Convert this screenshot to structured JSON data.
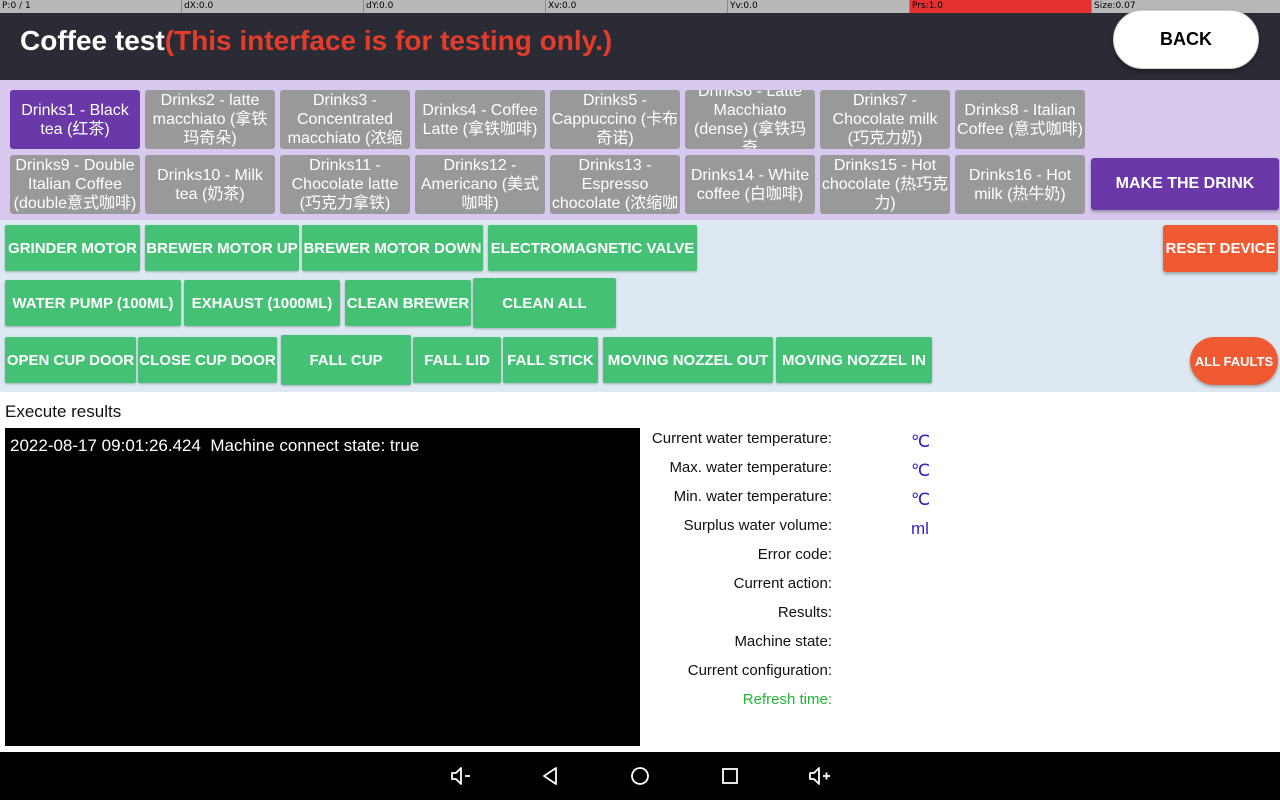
{
  "debug_bar": [
    "P:0 / 1",
    "dX:0.0",
    "dY:0.0",
    "Xv:0.0",
    "Yv:0.0",
    "Prs:1.0",
    "Size:0.07"
  ],
  "header": {
    "title": "Coffee test",
    "subtitle": "(This interface is for testing only.)",
    "back_label": "BACK"
  },
  "drinks": {
    "row1": [
      "Drinks1 - Black tea (红茶)",
      "Drinks2 - latte macchiato (拿铁玛奇朵)",
      "Drinks3 - Concentrated macchiato (浓缩",
      "Drinks4 - Coffee Latte (拿铁咖啡)",
      "Drinks5 - Cappuccino (卡布奇诺)",
      "Drinks6 - Latte Macchiato (dense) (拿铁玛奇",
      "Drinks7 - Chocolate milk (巧克力奶)",
      "Drinks8 - Italian Coffee (意式咖啡)"
    ],
    "row2": [
      "Drinks9 - Double Italian Coffee (double意式咖啡)",
      "Drinks10 - Milk tea (奶茶)",
      "Drinks11 - Chocolate latte (巧克力拿铁)",
      "Drinks12 - Americano (美式咖啡)",
      "Drinks13 - Espresso chocolate (浓缩咖",
      "Drinks14 - White coffee (白咖啡)",
      "Drinks15 - Hot chocolate (热巧克力)",
      "Drinks16 - Hot milk (热牛奶)"
    ],
    "selected_index": 0,
    "make_label": "MAKE THE DRINK"
  },
  "controls": {
    "row1": [
      "GRINDER MOTOR",
      "BREWER MOTOR UP",
      "BREWER MOTOR DOWN",
      "ELECTROMAGNETIC VALVE"
    ],
    "row2": [
      "WATER PUMP (100ML)",
      "EXHAUST (1000ML)",
      "CLEAN BREWER",
      "CLEAN ALL"
    ],
    "row3": [
      "OPEN CUP DOOR",
      "CLOSE CUP DOOR",
      "FALL CUP",
      "FALL LID",
      "FALL STICK",
      "MOVING NOZZEL OUT",
      "MOVING NOZZEL IN"
    ],
    "reset_label": "RESET DEVICE",
    "faults_label": "ALL FAULTS"
  },
  "results": {
    "label": "Execute results",
    "log": "2022-08-17 09:01:26.424  Machine connect state: true"
  },
  "status": {
    "labels": [
      "Current water temperature:",
      "Max. water temperature:",
      "Min. water temperature:",
      "Surplus water volume:",
      "Error code:",
      "Current action:",
      "Results:",
      "Machine state:",
      "Current configuration:",
      "Refresh time:"
    ],
    "units": [
      "℃",
      "℃",
      "℃",
      "ml"
    ]
  },
  "nav": [
    "volume-down-icon",
    "back-icon",
    "home-icon",
    "recents-icon",
    "volume-up-icon"
  ],
  "colors": {
    "header_bg": "#2b2b35",
    "warning_red": "#e43c2a",
    "drink_bg": "#999999",
    "drink_selected": "#6a38a8",
    "control_green": "#45c175",
    "reset_orange": "#f05a32",
    "unit_blue": "#3320c8",
    "refresh_green": "#22b538"
  }
}
